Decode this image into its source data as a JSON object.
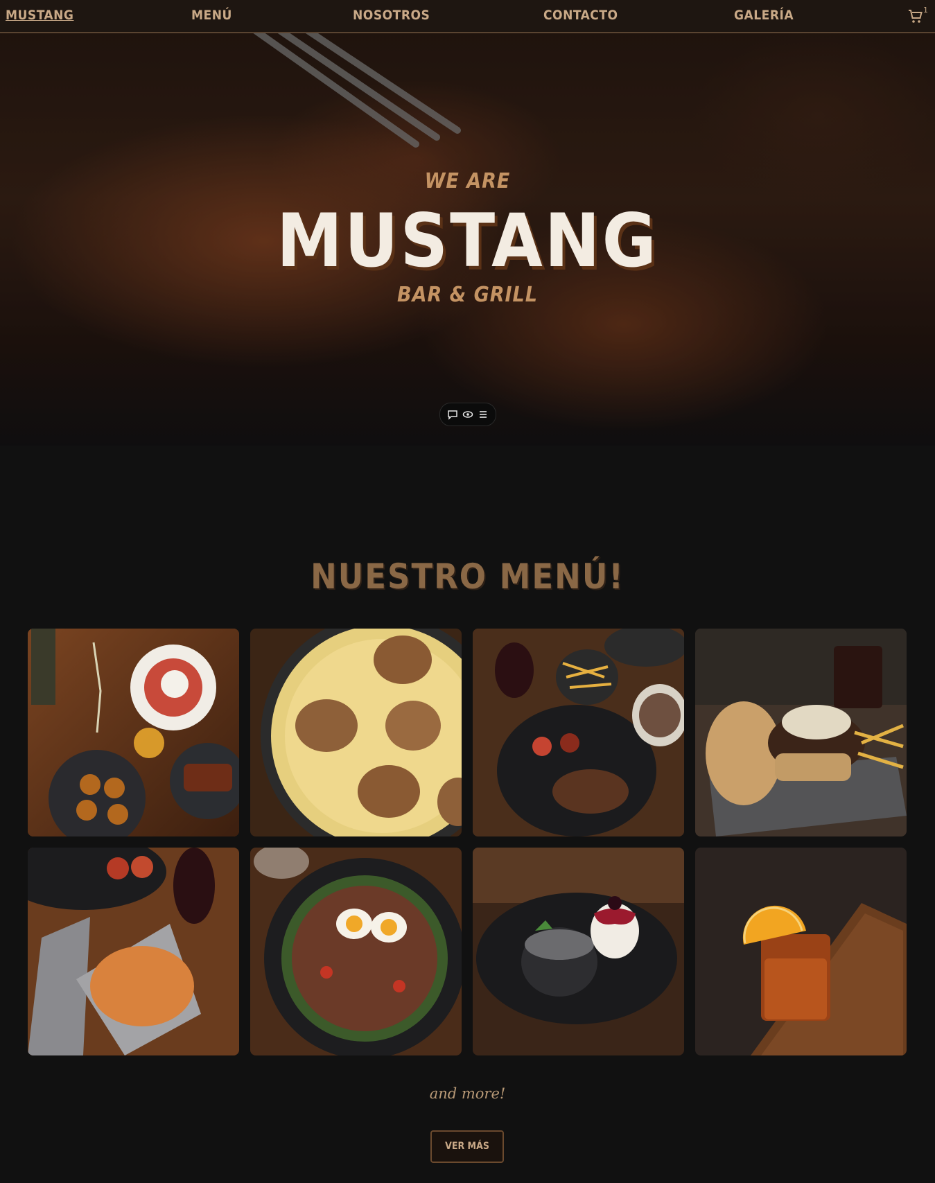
{
  "nav": {
    "brand": "MUSTANG",
    "items": [
      "MENÚ",
      "NOSOTROS",
      "CONTACTO",
      "GALERÍA"
    ],
    "cart_icon": "cart-icon",
    "cart_count": "1"
  },
  "hero": {
    "pre_title": "WE ARE",
    "title": "MUSTANG",
    "subtitle": "BAR & GRILL",
    "pill_icons": [
      "chat-icon",
      "eye-icon",
      "list-icon"
    ]
  },
  "menu": {
    "title": "NUESTRO MENÚ!",
    "tiles": [
      "platter-photo",
      "gratin-photo",
      "steak-fries-photo",
      "burger-photo",
      "mash-photo",
      "salad-egg-photo",
      "lava-cake-photo",
      "cocktail-photo"
    ],
    "and_more": "and more!",
    "button_label": "VER MÁS"
  },
  "colors": {
    "accent": "#c49363",
    "nav_bg": "#1e1611",
    "page_bg": "#111111",
    "title_brown": "#8a6846"
  }
}
